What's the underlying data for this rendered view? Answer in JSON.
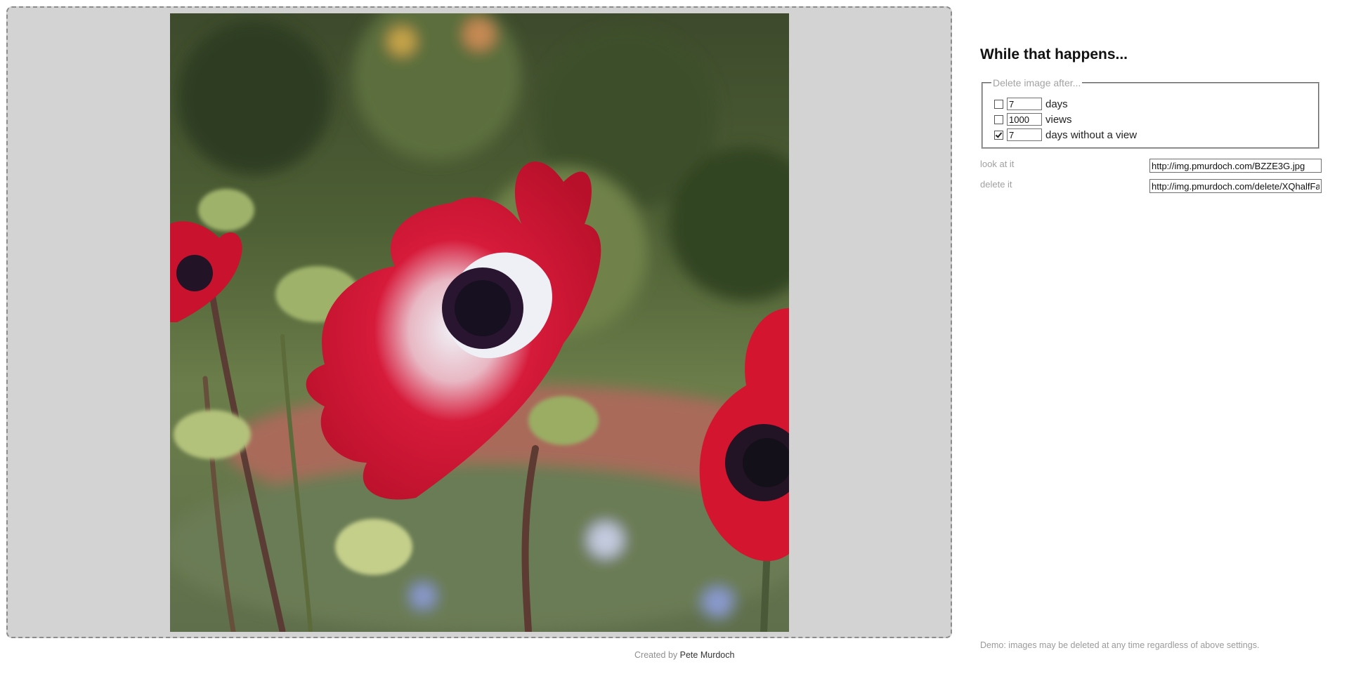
{
  "upload_area": {
    "image_alt": "Red anemone flowers",
    "colors": {
      "background": "#d3d3d3",
      "border": "#8c8c8c"
    }
  },
  "sidebar": {
    "heading": "While that happens...",
    "delete_options": {
      "legend": "Delete image after...",
      "options": [
        {
          "checked": false,
          "value": "7",
          "unit": "days"
        },
        {
          "checked": false,
          "value": "1000",
          "unit": "views"
        },
        {
          "checked": true,
          "value": "7",
          "unit": "days without a view"
        }
      ]
    },
    "links": {
      "view_label": "look at it",
      "view_url": "http://img.pmurdoch.com/BZZE3G.jpg",
      "delete_label": "delete it",
      "delete_url": "http://img.pmurdoch.com/delete/XQhalfFa"
    },
    "demo_note": "Demo: images may be deleted at any time regardless of above settings."
  },
  "footer": {
    "created_by": "Created by",
    "author": "Pete Murdoch"
  }
}
